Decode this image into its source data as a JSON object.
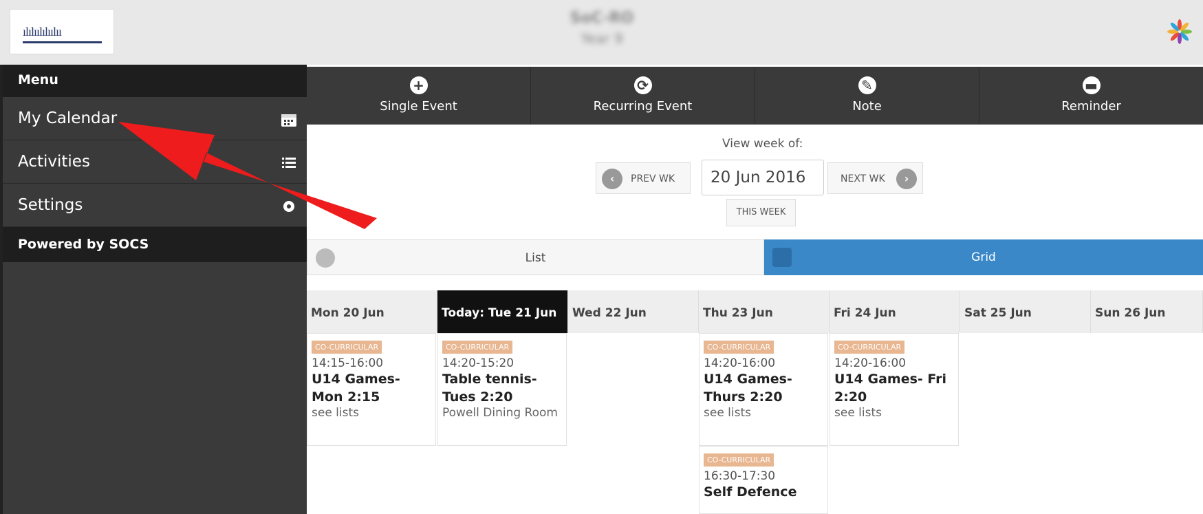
{
  "header": {
    "title": "SoC-RO",
    "subtitle": "Year 9"
  },
  "sidebar": {
    "menu_label": "Menu",
    "items": [
      {
        "label": "My Calendar",
        "icon": "calendar-icon"
      },
      {
        "label": "Activities",
        "icon": "list-icon"
      },
      {
        "label": "Settings",
        "icon": "gear-icon"
      }
    ],
    "powered": "Powered by SOCS"
  },
  "toolbar": {
    "buttons": [
      {
        "label": "Single Event",
        "icon": "plus-icon"
      },
      {
        "label": "Recurring Event",
        "icon": "refresh-icon"
      },
      {
        "label": "Note",
        "icon": "pencil-icon"
      },
      {
        "label": "Reminder",
        "icon": "speech-bubble-icon"
      }
    ]
  },
  "week_nav": {
    "view_label": "View week of:",
    "prev": "PREV WK",
    "next": "NEXT WK",
    "date_value": "20 Jun 2016",
    "this_week": "THIS WEEK"
  },
  "toggle": {
    "list": "List",
    "grid": "Grid",
    "active": "grid"
  },
  "calendar": {
    "days": [
      "Mon 20 Jun",
      "Today: Tue 21 Jun",
      "Wed 22 Jun",
      "Thu 23 Jun",
      "Fri 24 Jun",
      "Sat 25 Jun",
      "Sun 26 Jun"
    ],
    "events": [
      {
        "badge": "CO-CURRICULAR",
        "time": "14:15-16:00",
        "title": "U14 Games- Mon 2:15",
        "location": "see lists"
      },
      {
        "badge": "CO-CURRICULAR",
        "time": "14:20-15:20",
        "title": "Table tennis- Tues 2:20",
        "location": "Powell Dining Room"
      },
      {
        "badge": "CO-CURRICULAR",
        "time": "14:20-16:00",
        "title": "U14 Games- Thurs 2:20",
        "location": "see lists"
      },
      {
        "badge": "CO-CURRICULAR",
        "time": "14:20-16:00",
        "title": "U14 Games- Fri 2:20",
        "location": "see lists"
      },
      {
        "badge": "CO-CURRICULAR",
        "time": "16:30-17:30",
        "title": "Self Defence",
        "location": ""
      }
    ]
  },
  "colors": {
    "header_bg": "#e8e8e8",
    "sidebar_bg": "#3a3a3a",
    "grid_active": "#3b88c8",
    "badge": "#e8b690",
    "arrow": "#ee1c1c"
  }
}
